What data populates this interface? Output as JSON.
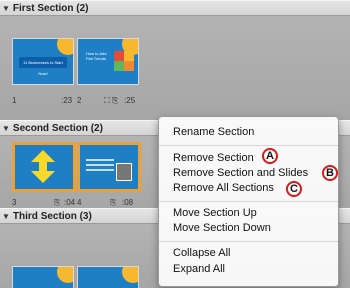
{
  "sections": [
    {
      "title": "First Section (2)",
      "slides": [
        {
          "number": "1",
          "time": ":23",
          "title": "11 Businesses to Start Now!"
        },
        {
          "number": "2",
          "time": ":25",
          "title": "How to Add Flat Trends"
        }
      ]
    },
    {
      "title": "Second Section (2)",
      "slides": [
        {
          "number": "3",
          "time": ":04"
        },
        {
          "number": "4",
          "time": ":08"
        }
      ]
    },
    {
      "title": "Third Section (3)",
      "slides": []
    }
  ],
  "menu": {
    "items": [
      "Rename Section",
      "Remove Section",
      "Remove Section and Slides",
      "Remove All Sections",
      "Move Section Up",
      "Move Section Down",
      "Collapse All",
      "Expand All"
    ]
  },
  "callouts": [
    "A",
    "B",
    "C"
  ],
  "icons": {
    "expand": "triangle-down",
    "transition": "transition-icon",
    "animation": "animation-icon"
  },
  "colors": {
    "selection": "#f0a030",
    "callout_ring": "#d61a1a",
    "slide_bg": "#1e7fc4"
  }
}
